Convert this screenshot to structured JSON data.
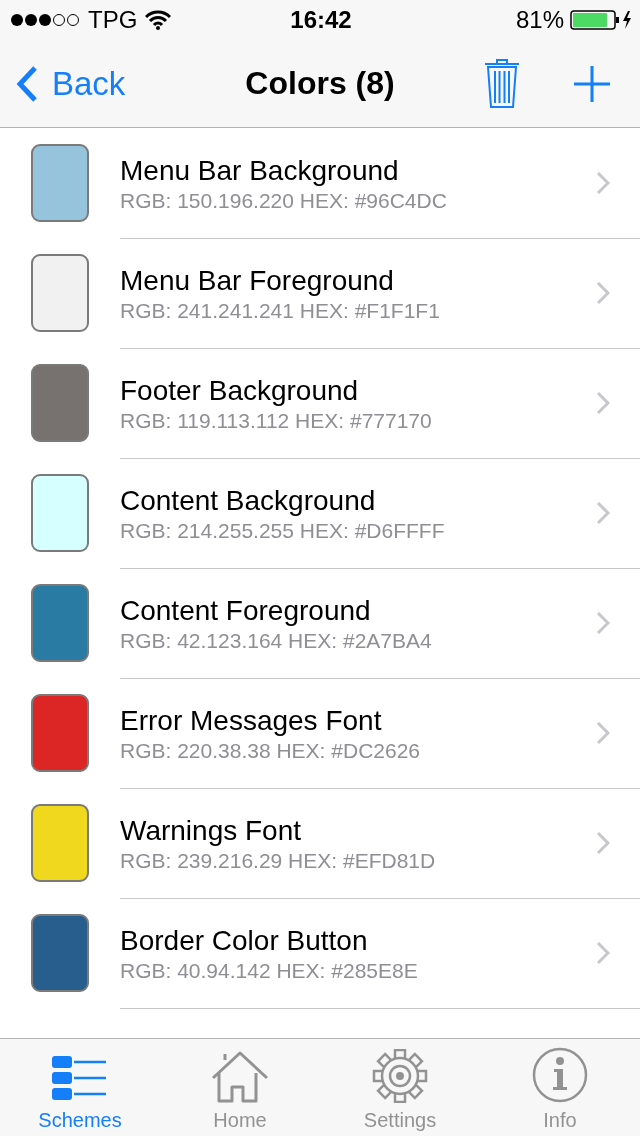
{
  "status_bar": {
    "carrier": "TPG",
    "time": "16:42",
    "battery": "81%"
  },
  "nav_bar": {
    "back": "Back",
    "title": "Colors (8)"
  },
  "colors": [
    {
      "name": "Menu Bar Background",
      "detail": "RGB: 150.196.220 HEX: #96C4DC",
      "color": "#96c4dc"
    },
    {
      "name": "Menu Bar Foreground",
      "detail": "RGB: 241.241.241 HEX: #F1F1F1",
      "color": "#f1f1f1"
    },
    {
      "name": "Footer Background",
      "detail": "RGB: 119.113.112 HEX: #777170",
      "color": "#777170"
    },
    {
      "name": "Content Background",
      "detail": "RGB: 214.255.255 HEX: #D6FFFF",
      "color": "#d6ffff"
    },
    {
      "name": "Content Foreground",
      "detail": "RGB: 42.123.164 HEX: #2A7BA4",
      "color": "#2a7ba4"
    },
    {
      "name": "Error Messages Font",
      "detail": "RGB: 220.38.38 HEX: #DC2626",
      "color": "#dc2626"
    },
    {
      "name": "Warnings Font",
      "detail": "RGB: 239.216.29 HEX: #EFD81D",
      "color": "#efd81d"
    },
    {
      "name": "Border Color Button",
      "detail": "RGB: 40.94.142 HEX: #285E8E",
      "color": "#285e8e"
    }
  ],
  "tab_bar": [
    {
      "kind": "list",
      "label": "Schemes",
      "selected": true
    },
    {
      "kind": "home",
      "label": "Home",
      "selected": false
    },
    {
      "kind": "gear",
      "label": "Settings",
      "selected": false
    },
    {
      "kind": "info",
      "label": "Info",
      "selected": false
    }
  ]
}
